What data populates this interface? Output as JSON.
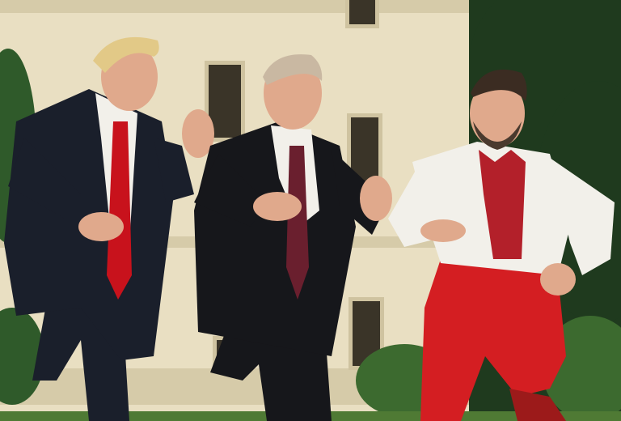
{
  "scene": {
    "colors": {
      "facade": "#e9dfc2",
      "facade_shadow": "#d6cba9",
      "window": "#3a3428",
      "window_frame": "#cfc3a0",
      "trees_dark": "#1f3a1e",
      "trees_mid": "#2f5a2a",
      "lawn": "#4f7a34",
      "hedge": "#3c6a2f",
      "suit": "#1a1f2b",
      "suit_black": "#16171b",
      "shirt_white": "#f2f0ea",
      "tie_red": "#c8121c",
      "tie_burgundy": "#6a1f2e",
      "skin": "#e0a98c",
      "hair_blond": "#e2c987",
      "hair_gray": "#c9b8a2",
      "hair_dark": "#3b2c22",
      "beard": "#4a3a2e",
      "trousers_red": "#d41e22",
      "embroidery_red": "#b3202a",
      "embroidery_dark": "#3b2a2a",
      "boots_red": "#9c1a1a"
    }
  }
}
